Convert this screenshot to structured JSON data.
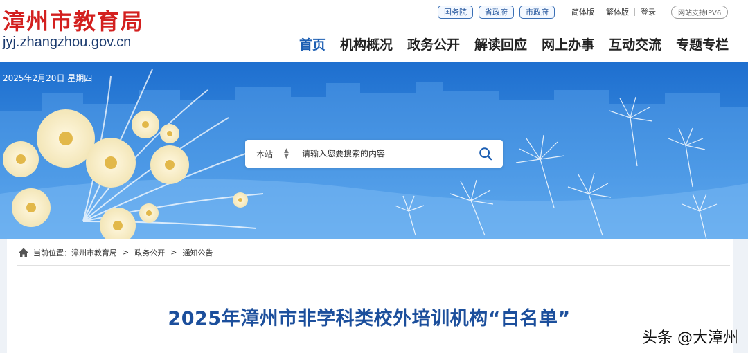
{
  "header": {
    "site_title": "漳州市教育局",
    "domain": "jyj.zhangzhou.gov.cn",
    "gov_links": [
      "国务院",
      "省政府",
      "市政府"
    ],
    "version_links": [
      "简体版",
      "繁体版"
    ],
    "login": "登录",
    "ipv6": "网站支持IPV6"
  },
  "nav": {
    "items": [
      "首页",
      "机构概况",
      "政务公开",
      "解读回应",
      "网上办事",
      "互动交流",
      "专题专栏"
    ]
  },
  "banner": {
    "date": "2025年2月20日 星期四"
  },
  "search": {
    "scope": "本站",
    "placeholder": "请输入您要搜索的内容",
    "icon": "search-icon"
  },
  "breadcrumb": {
    "label": "当前位置：",
    "items": [
      "漳州市教育局",
      "政务公开",
      "通知公告"
    ],
    "icon": "home-icon"
  },
  "article": {
    "title": "2025年漳州市非学科类校外培训机构“白名单”"
  },
  "watermark": "头条 @大漳州",
  "colors": {
    "brand_red": "#d3201f",
    "nav_active": "#1d5fb3",
    "title_blue": "#1c4f9c",
    "banner_blue": "#2c7fd6"
  }
}
